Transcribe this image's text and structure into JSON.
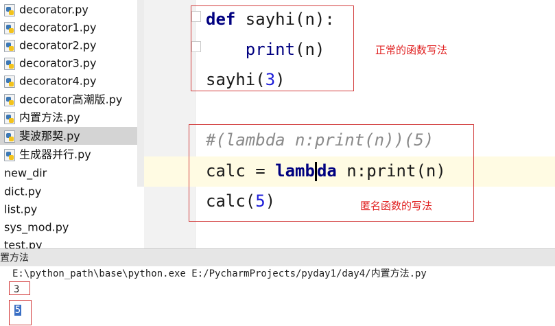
{
  "project_tree": {
    "files": [
      {
        "label": "decorator.py",
        "icon": "python-file-icon"
      },
      {
        "label": "decorator1.py",
        "icon": "python-file-icon"
      },
      {
        "label": "decorator2.py",
        "icon": "python-file-icon"
      },
      {
        "label": "decorator3.py",
        "icon": "python-file-icon"
      },
      {
        "label": "decorator4.py",
        "icon": "python-file-icon"
      },
      {
        "label": "decorator高潮版.py",
        "icon": "python-file-icon"
      },
      {
        "label": "内置方法.py",
        "icon": "python-file-icon"
      },
      {
        "label": "斐波那契.py",
        "icon": "python-file-icon"
      },
      {
        "label": "生成器并行.py",
        "icon": "python-file-icon"
      }
    ],
    "selected_index": 7,
    "outer_items": [
      "new_dir",
      "dict.py",
      "list.py",
      "sys_mod.py",
      "test.py"
    ]
  },
  "editor": {
    "tokens": {
      "def": "def",
      "sayhi_sig": " sayhi(n):",
      "indent": "    ",
      "print_call": "print",
      "print_args": "(n)",
      "sayhi_call": "sayhi(",
      "arg3": "3",
      "close_paren": ")",
      "comment": "#(lambda n:print(n))(5)",
      "calc_assign": "calc = ",
      "lambda_a": "lamb",
      "lambda_b": "da",
      "lambda_rest": " n:print(n)",
      "calc_call": "calc(",
      "arg5": "5"
    },
    "annotations": {
      "normal": "正常的函数写法",
      "anonymous": "匿名函数的写法"
    }
  },
  "run_panel": {
    "title": "置方法",
    "command": "E:\\python_path\\base\\python.exe E:/PycharmProjects/pyday1/day4/内置方法.py",
    "outputs": [
      "3",
      "5"
    ]
  },
  "colors": {
    "annotation": "#e02020",
    "keyword": "#000080",
    "number": "#1c1cd9",
    "comment": "#8a8a8a",
    "caret_line": "#fffbe3"
  }
}
